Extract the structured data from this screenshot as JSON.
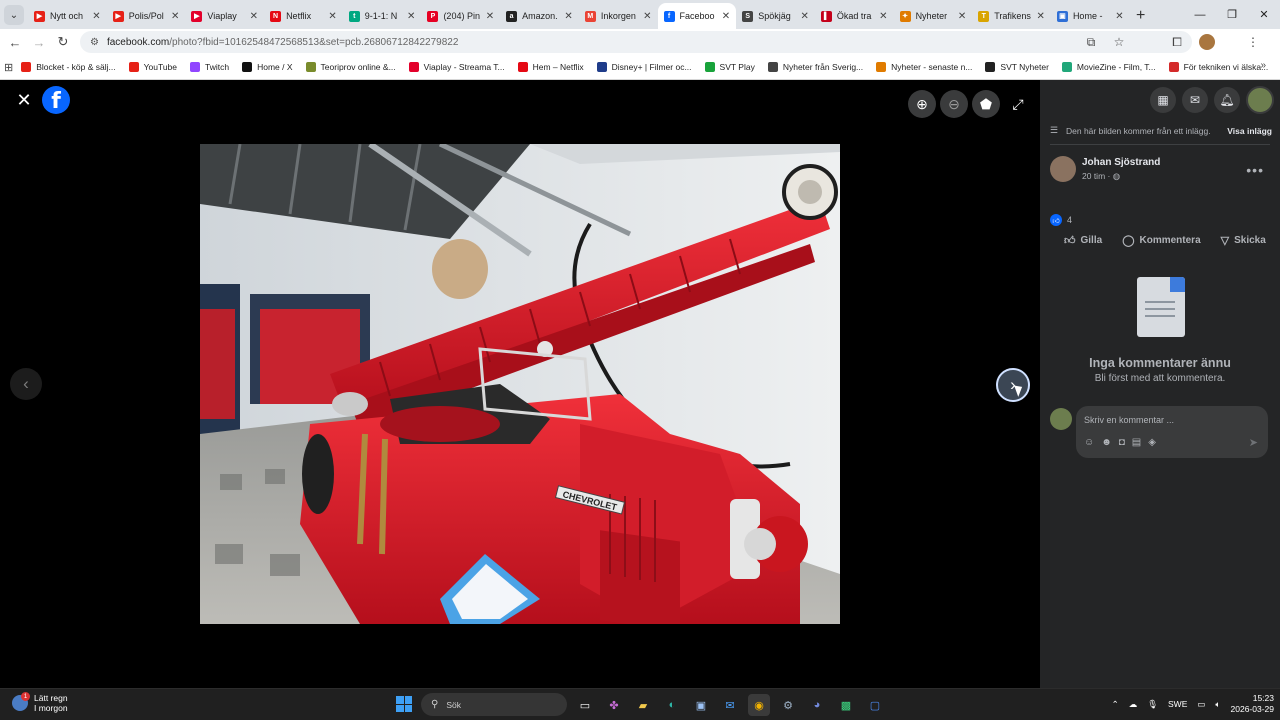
{
  "browser": {
    "tabs": [
      {
        "label": "Nytt och",
        "color": "#e62117",
        "glyph": "▶"
      },
      {
        "label": "Polis/Pol",
        "color": "#e62117",
        "glyph": "▶"
      },
      {
        "label": "Viaplay",
        "color": "#e3002b",
        "glyph": "▶"
      },
      {
        "label": "Netflix",
        "color": "#e50914",
        "glyph": "N"
      },
      {
        "label": "9-1-1: N",
        "color": "#00a881",
        "glyph": "t"
      },
      {
        "label": "(204) Pin",
        "color": "#e60023",
        "glyph": "P"
      },
      {
        "label": "Amazon.",
        "color": "#222222",
        "glyph": "a"
      },
      {
        "label": "Inkorgen",
        "color": "#ea4335",
        "glyph": "M"
      },
      {
        "label": "Faceboo",
        "color": "#0866ff",
        "glyph": "f"
      },
      {
        "label": "Spökjäg",
        "color": "#444444",
        "glyph": "S"
      },
      {
        "label": "Ökad tra",
        "color": "#c4001a",
        "glyph": "▌"
      },
      {
        "label": "Nyheter",
        "color": "#e07b00",
        "glyph": "✦"
      },
      {
        "label": "Trafikens",
        "color": "#d9a400",
        "glyph": "T"
      },
      {
        "label": "Home -",
        "color": "#2f6fd6",
        "glyph": "▣"
      }
    ],
    "active_tab": 8,
    "url_domain": "facebook.com",
    "url_path": "/photo?fbid=10162548472568513&set=pcb.26806712842279822",
    "bookmarks": [
      {
        "label": "Blocket - köp & sälj...",
        "color": "#e62117"
      },
      {
        "label": "YouTube",
        "color": "#e62117"
      },
      {
        "label": "Twitch",
        "color": "#9146ff"
      },
      {
        "label": "Home / X",
        "color": "#111111"
      },
      {
        "label": "Teoriprov online &...",
        "color": "#7a8c2c"
      },
      {
        "label": "Viaplay - Streama T...",
        "color": "#e3002b"
      },
      {
        "label": "Hem – Netflix",
        "color": "#e50914"
      },
      {
        "label": "Disney+ | Filmer oc...",
        "color": "#1f3c8a"
      },
      {
        "label": "SVT Play",
        "color": "#19a33b"
      },
      {
        "label": "Nyheter från Sverig...",
        "color": "#444444"
      },
      {
        "label": "Nyheter - senaste n...",
        "color": "#e07b00"
      },
      {
        "label": "SVT Nyheter",
        "color": "#222222"
      },
      {
        "label": "MovieZine - Film, T...",
        "color": "#21a77a"
      },
      {
        "label": "För tekniken vi älska...",
        "color": "#d42a2a"
      }
    ]
  },
  "post": {
    "notice": "Den här bilden kommer från ett inlägg.",
    "view_post": "Visa inlägg",
    "author": "Johan Sjöstrand",
    "time": "20 tim · ",
    "reactions_count": "4",
    "actions": {
      "like": "Gilla",
      "comment": "Kommentera",
      "share": "Skicka"
    },
    "empty_title": "Inga kommentarer ännu",
    "empty_sub": "Bli först med att kommentera.",
    "comment_placeholder": "Skriv en kommentar ..."
  },
  "photo": {
    "plate_text": "CHEVROLET"
  },
  "taskbar": {
    "weather_line1": "Lätt regn",
    "weather_line2": "I morgon",
    "weather_badge": "1",
    "search_label": "Sök",
    "lang": "SWE",
    "time": "15:23",
    "date": "2026-03-29"
  }
}
